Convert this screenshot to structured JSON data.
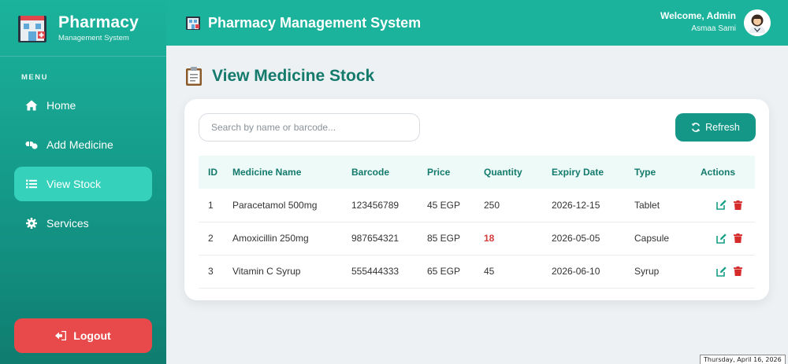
{
  "sidebar": {
    "brand_title": "Pharmacy",
    "brand_subtitle": "Management System",
    "menu_label": "MENU",
    "items": [
      {
        "label": "Home",
        "icon": "home-icon",
        "active": false
      },
      {
        "label": "Add Medicine",
        "icon": "pills-icon",
        "active": false
      },
      {
        "label": "View Stock",
        "icon": "list-icon",
        "active": true
      },
      {
        "label": "Services",
        "icon": "gear-icon",
        "active": false
      }
    ],
    "logout_label": "Logout"
  },
  "header": {
    "title": "Pharmacy Management System",
    "welcome": "Welcome, Admin",
    "user_name": "Asmaa Sami"
  },
  "main": {
    "page_title": "View Medicine Stock",
    "search_placeholder": "Search by name or barcode...",
    "search_value": "",
    "refresh_label": "Refresh",
    "table": {
      "columns": [
        "ID",
        "Medicine Name",
        "Barcode",
        "Price",
        "Quantity",
        "Expiry Date",
        "Type",
        "Actions"
      ],
      "rows": [
        {
          "id": "1",
          "name": "Paracetamol 500mg",
          "barcode": "123456789",
          "price": "45 EGP",
          "quantity": "250",
          "expiry": "2026-12-15",
          "type": "Tablet",
          "low_stock": false
        },
        {
          "id": "2",
          "name": "Amoxicillin 250mg",
          "barcode": "987654321",
          "price": "85 EGP",
          "quantity": "18",
          "expiry": "2026-05-05",
          "type": "Capsule",
          "low_stock": true
        },
        {
          "id": "3",
          "name": "Vitamin C Syrup",
          "barcode": "555444333",
          "price": "65 EGP",
          "quantity": "45",
          "expiry": "2026-06-10",
          "type": "Syrup",
          "low_stock": false
        }
      ]
    }
  },
  "taskbar_tooltip": "Thursday, April 16, 2026",
  "colors": {
    "primary": "#1bb39c",
    "primary_dark": "#149787",
    "active_item": "#36d1bb",
    "title_text": "#137a6c",
    "danger": "#e8494a",
    "low_stock": "#d63a3a",
    "edit_icon": "#14a085",
    "delete_icon": "#d62b2b"
  }
}
